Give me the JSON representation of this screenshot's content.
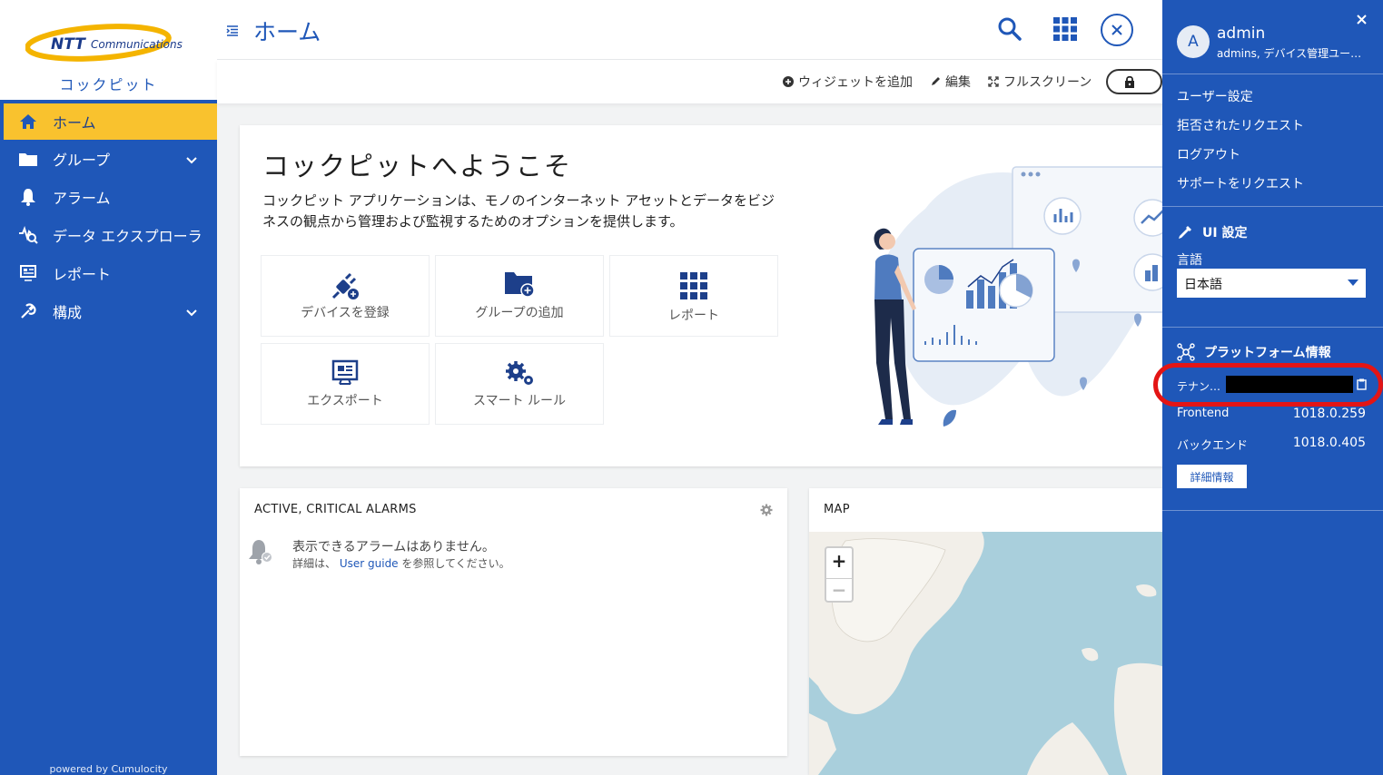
{
  "brand": {
    "logo_text_ntt": "NTT",
    "logo_text_comm": "Communications",
    "app_name": "コックピット",
    "powered_by": "powered by Cumulocity"
  },
  "nav": {
    "items": [
      {
        "label": "ホーム",
        "icon": "home-icon",
        "active": true
      },
      {
        "label": "グループ",
        "icon": "folder-icon",
        "expandable": true
      },
      {
        "label": "アラーム",
        "icon": "bell-icon"
      },
      {
        "label": "データ エクスプローラ",
        "icon": "data-explorer-icon"
      },
      {
        "label": "レポート",
        "icon": "report-icon"
      },
      {
        "label": "構成",
        "icon": "tools-icon",
        "expandable": true
      }
    ]
  },
  "header": {
    "title": "ホーム",
    "add_widget": "ウィジェットを追加",
    "edit": "編集",
    "fullscreen": "フルスクリーン"
  },
  "welcome": {
    "title": "コックピットへようこそ",
    "description": "コックピット アプリケーションは、モノのインターネット アセットとデータをビジネスの観点から管理および監視するためのオプションを提供します。",
    "tiles": [
      {
        "label": "デバイスを登録",
        "icon": "plug-add-icon"
      },
      {
        "label": "グループの追加",
        "icon": "folder-add-icon"
      },
      {
        "label": "レポート",
        "icon": "grid-report-icon"
      },
      {
        "label": "エクスポート",
        "icon": "export-icon"
      },
      {
        "label": "スマート ルール",
        "icon": "gears-icon"
      }
    ]
  },
  "alarms_widget": {
    "title": "ACTIVE, CRITICAL ALARMS",
    "empty_message": "表示できるアラームはありません。",
    "details_prefix": "詳細は、",
    "guide_link": "User guide",
    "details_suffix": "を参照してください。"
  },
  "map_widget": {
    "title": "MAP",
    "zoom_in": "+",
    "zoom_out": "−"
  },
  "user_panel": {
    "avatar_letter": "A",
    "user_name": "admin",
    "user_roles": "admins, デバイス管理ユー…",
    "links": [
      "ユーザー設定",
      "拒否されたリクエスト",
      "ログアウト",
      "サポートをリクエスト"
    ],
    "ui_settings_heading": "UI 設定",
    "language_label": "言語",
    "language_value": "日本語",
    "platform_heading": "プラットフォーム情報",
    "tenant_label": "テナン…",
    "frontend_label": "Frontend",
    "frontend_value": "1018.0.259",
    "backend_label": "バックエンド",
    "backend_value": "1018.0.405",
    "details_button": "詳細情報"
  },
  "colors": {
    "primary": "#1f57b8",
    "accent": "#f9c22e",
    "highlight_ring": "#e31515"
  }
}
